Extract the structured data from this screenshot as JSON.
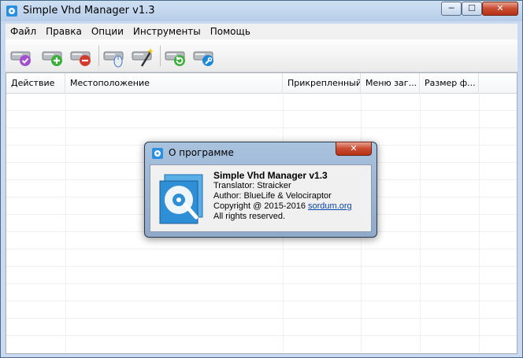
{
  "window": {
    "title": "Simple Vhd Manager v1.3",
    "controls": {
      "minimize": "─",
      "maximize": "☐",
      "close": "✕"
    }
  },
  "menu": [
    "Файл",
    "Правка",
    "Опции",
    "Инструменты",
    "Помощь"
  ],
  "toolbar": {
    "icons": [
      "vhd-check-icon",
      "vhd-add-icon",
      "vhd-remove-icon",
      "vhd-mouse-icon",
      "vhd-wand-icon",
      "vhd-refresh-icon",
      "vhd-wrench-icon"
    ]
  },
  "table": {
    "columns": [
      "Действие",
      "Местоположение",
      "Прикрепленный",
      "Меню заг...",
      "Размер ф..."
    ]
  },
  "about_dialog": {
    "title": "О программе",
    "close": "✕",
    "product": "Simple Vhd Manager v1.3",
    "translator": "Translator: Straicker",
    "author": "Author: BlueLife & Velociraptor",
    "copyright": "Copyright @ 2015-2016",
    "link": "sordum.org",
    "rights": "All rights reserved."
  },
  "colors": {
    "accent": "#1e88d8",
    "add": "#3cae3a",
    "remove": "#d23a2c",
    "check": "#a24fd0"
  }
}
